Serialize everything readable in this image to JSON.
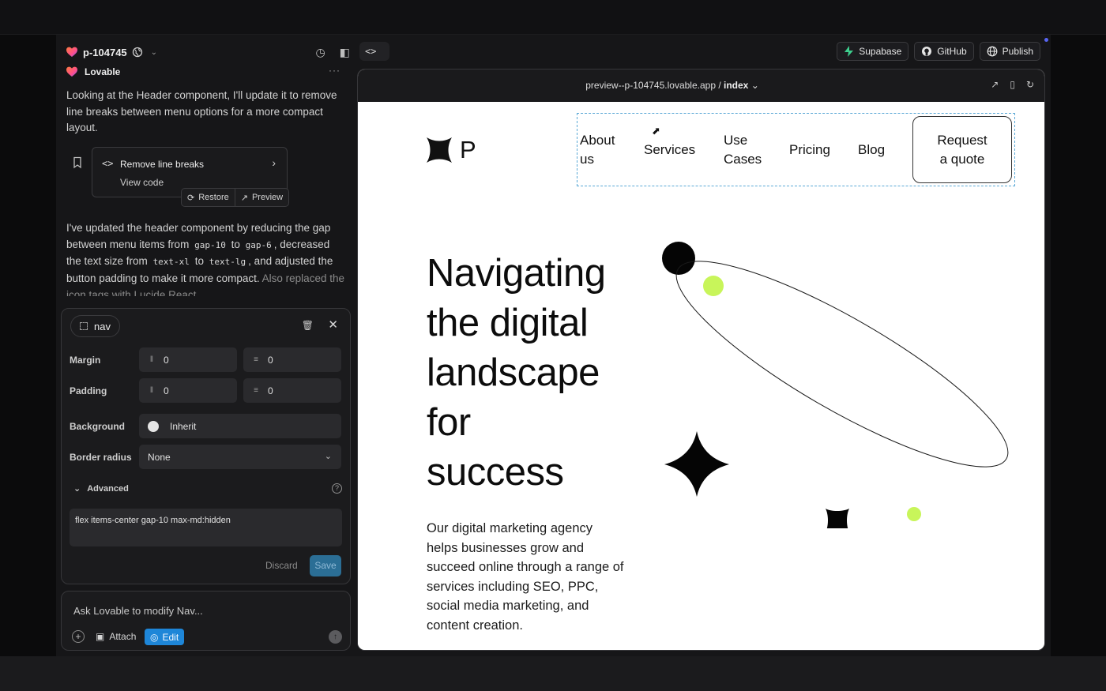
{
  "project": {
    "name": "p-104745",
    "author": "Lovable"
  },
  "chat": {
    "message1": "Looking at the Header component, I'll update it to remove line breaks between menu options for a more compact layout.",
    "card_title": "Remove line breaks",
    "view_code": "View code",
    "restore": "Restore",
    "preview": "Preview",
    "message2": {
      "p1": "I've updated the header component by reducing the gap between menu items from",
      "code1": "gap-10",
      "p2": "to",
      "code2": "gap-6",
      "p3": ", decreased the text size from",
      "code3": "text-xl",
      "p4": "to",
      "code4": "text-lg",
      "p5": ", and adjusted the button padding to make it more compact.",
      "p6": "Also replaced the icon tags with Lucide React"
    }
  },
  "editor": {
    "element": "nav",
    "margin_label": "Margin",
    "margin_x": "0",
    "margin_y": "0",
    "padding_label": "Padding",
    "padding_x": "0",
    "padding_y": "0",
    "background_label": "Background",
    "background_value": "Inherit",
    "radius_label": "Border radius",
    "radius_value": "None",
    "advanced_label": "Advanced",
    "classes": "flex items-center gap-10 max-md:hidden",
    "discard": "Discard",
    "save": "Save"
  },
  "prompt": {
    "placeholder": "Ask Lovable to modify Nav...",
    "attach": "Attach",
    "edit": "Edit"
  },
  "toolbar": {
    "supabase": "Supabase",
    "github": "GitHub",
    "publish": "Publish"
  },
  "browser": {
    "url": "preview--p-104745.lovable.app",
    "sep": " / ",
    "route": "index"
  },
  "site": {
    "logo_letter": "P",
    "nav": {
      "about_1": "About",
      "about_2": "us",
      "services": "Services",
      "use_1": "Use",
      "use_2": "Cases",
      "pricing": "Pricing",
      "blog": "Blog",
      "quote_1": "Request",
      "quote_2": "a quote"
    },
    "hero": [
      "Navigating",
      "the digital",
      "landscape",
      "for",
      "success"
    ],
    "subtext": "Our digital marketing agency helps businesses grow and succeed online through a range of services including SEO, PPC, social media marketing, and content creation."
  },
  "colors": {
    "accent_blue": "#1e86d8",
    "lime": "#c8f55a",
    "supabase_green": "#3ecf8e"
  },
  "icons": [
    "heart-logo-icon",
    "globe-icon",
    "history-icon",
    "sidebar-icon",
    "bookmark-icon",
    "code-icon",
    "chevron-right-icon",
    "restore-icon",
    "external-link-icon",
    "trash-icon",
    "close-icon",
    "help-icon",
    "plus-icon",
    "attach-icon",
    "edit-icon",
    "send-icon",
    "supabase-icon",
    "github-icon",
    "globe-publish-icon",
    "open-new-tab-icon",
    "mobile-icon",
    "refresh-icon"
  ]
}
